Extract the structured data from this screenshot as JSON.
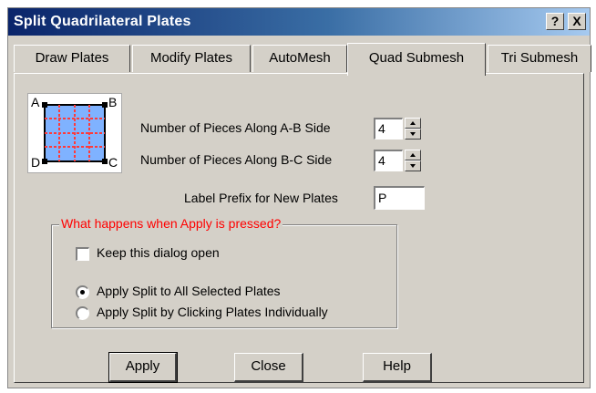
{
  "window": {
    "title": "Split Quadrilateral Plates",
    "help_button": "?",
    "close_button": "X"
  },
  "tabs": [
    {
      "label": "Draw Plates",
      "active": false
    },
    {
      "label": "Modify Plates",
      "active": false
    },
    {
      "label": "AutoMesh",
      "active": false
    },
    {
      "label": "Quad Submesh",
      "active": true
    },
    {
      "label": "Tri Submesh",
      "active": false
    }
  ],
  "diagram": {
    "corners": [
      "A",
      "B",
      "C",
      "D"
    ],
    "colors": {
      "fill": "#7fb2ff",
      "edge": "#000000",
      "split_lines": "#ff3a3a"
    }
  },
  "fields": {
    "ab_label": "Number of Pieces Along A-B Side",
    "ab_value": "4",
    "bc_label": "Number of Pieces Along B-C Side",
    "bc_value": "4",
    "prefix_label": "Label Prefix for New Plates",
    "prefix_value": "P"
  },
  "group": {
    "legend": "What happens when Apply is pressed?",
    "legend_color": "#ff0000",
    "keep_open_label": "Keep this dialog open",
    "keep_open_checked": false,
    "radio_all_label": "Apply Split to All Selected Plates",
    "radio_all_checked": true,
    "radio_click_label": "Apply Split by Clicking Plates Individually",
    "radio_click_checked": false
  },
  "buttons": {
    "apply": "Apply",
    "close": "Close",
    "help": "Help"
  },
  "colors": {
    "dialog_bg": "#d4d0c8",
    "titlebar_start": "#0a246a",
    "titlebar_end": "#a6caf0"
  }
}
